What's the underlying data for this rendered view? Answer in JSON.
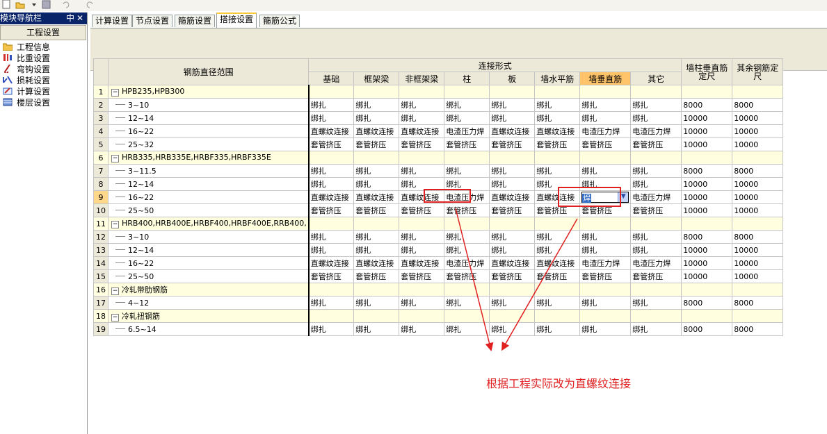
{
  "nav_panel": {
    "title": "模块导航栏",
    "pin": "中",
    "close": "✕",
    "section": "工程设置",
    "items": [
      {
        "label": "工程信息",
        "icon": "folder-info-icon"
      },
      {
        "label": "比重设置",
        "icon": "weight-icon"
      },
      {
        "label": "弯钩设置",
        "icon": "hook-icon"
      },
      {
        "label": "损耗设置",
        "icon": "loss-icon"
      },
      {
        "label": "计算设置",
        "icon": "calc-icon"
      },
      {
        "label": "楼层设置",
        "icon": "floor-icon"
      }
    ]
  },
  "tabs": [
    "计算设置",
    "节点设置",
    "箍筋设置",
    "搭接设置",
    "箍筋公式"
  ],
  "active_tab": "搭接设置",
  "table": {
    "header_range": "钢筋直径范围",
    "header_group": "连接形式",
    "columns": [
      "基础",
      "框架梁",
      "非框架梁",
      "柱",
      "板",
      "墙水平筋",
      "墙垂直筋",
      "其它"
    ],
    "col_extra1": "墙柱垂直筋定尺",
    "col_extra2": "其余钢筋定尺",
    "rows": [
      {
        "n": "1",
        "group": true,
        "label": "HPB235,HPB300",
        "cells": []
      },
      {
        "n": "2",
        "label": "3~10",
        "cells": [
          "绑扎",
          "绑扎",
          "绑扎",
          "绑扎",
          "绑扎",
          "绑扎",
          "绑扎",
          "绑扎",
          "8000",
          "8000"
        ]
      },
      {
        "n": "3",
        "label": "12~14",
        "cells": [
          "绑扎",
          "绑扎",
          "绑扎",
          "绑扎",
          "绑扎",
          "绑扎",
          "绑扎",
          "绑扎",
          "10000",
          "10000"
        ]
      },
      {
        "n": "4",
        "label": "16~22",
        "cells": [
          "直螺纹连接",
          "直螺纹连接",
          "直螺纹连接",
          "电渣压力焊",
          "直螺纹连接",
          "直螺纹连接",
          "电渣压力焊",
          "电渣压力焊",
          "10000",
          "10000"
        ]
      },
      {
        "n": "5",
        "label": "25~32",
        "cells": [
          "套管挤压",
          "套管挤压",
          "套管挤压",
          "套管挤压",
          "套管挤压",
          "套管挤压",
          "套管挤压",
          "套管挤压",
          "10000",
          "10000"
        ]
      },
      {
        "n": "6",
        "group": true,
        "label": "HRB335,HRB335E,HRBF335,HRBF335E",
        "cells": []
      },
      {
        "n": "7",
        "label": "3~11.5",
        "cells": [
          "绑扎",
          "绑扎",
          "绑扎",
          "绑扎",
          "绑扎",
          "绑扎",
          "绑扎",
          "绑扎",
          "8000",
          "8000"
        ]
      },
      {
        "n": "8",
        "label": "12~14",
        "cells": [
          "绑扎",
          "绑扎",
          "绑扎",
          "绑扎",
          "绑扎",
          "绑扎",
          "绑扎",
          "绑扎",
          "10000",
          "10000"
        ]
      },
      {
        "n": "9",
        "label": "16~22",
        "cells": [
          "直螺纹连接",
          "直螺纹连接",
          "直螺纹连接",
          "电渣压力焊",
          "直螺纹连接",
          "直螺纹连接",
          "焊",
          "电渣压力焊",
          "10000",
          "10000"
        ]
      },
      {
        "n": "10",
        "label": "25~50",
        "cells": [
          "套管挤压",
          "套管挤压",
          "套管挤压",
          "套管挤压",
          "套管挤压",
          "套管挤压",
          "套管挤压",
          "套管挤压",
          "10000",
          "10000"
        ]
      },
      {
        "n": "11",
        "group": true,
        "label": "HRB400,HRB400E,HRBF400,HRBF400E,RRB400,",
        "cells": []
      },
      {
        "n": "12",
        "label": "3~10",
        "cells": [
          "绑扎",
          "绑扎",
          "绑扎",
          "绑扎",
          "绑扎",
          "绑扎",
          "绑扎",
          "绑扎",
          "8000",
          "8000"
        ]
      },
      {
        "n": "13",
        "label": "12~14",
        "cells": [
          "绑扎",
          "绑扎",
          "绑扎",
          "绑扎",
          "绑扎",
          "绑扎",
          "绑扎",
          "绑扎",
          "10000",
          "10000"
        ]
      },
      {
        "n": "14",
        "label": "16~22",
        "cells": [
          "直螺纹连接",
          "直螺纹连接",
          "直螺纹连接",
          "电渣压力焊",
          "直螺纹连接",
          "直螺纹连接",
          "电渣压力焊",
          "电渣压力焊",
          "10000",
          "10000"
        ]
      },
      {
        "n": "15",
        "label": "25~50",
        "cells": [
          "套管挤压",
          "套管挤压",
          "套管挤压",
          "套管挤压",
          "套管挤压",
          "套管挤压",
          "套管挤压",
          "套管挤压",
          "10000",
          "10000"
        ]
      },
      {
        "n": "16",
        "group": true,
        "label": "冷轧带肋钢筋",
        "cells": []
      },
      {
        "n": "17",
        "label": "4~12",
        "cells": [
          "绑扎",
          "绑扎",
          "绑扎",
          "绑扎",
          "绑扎",
          "绑扎",
          "绑扎",
          "绑扎",
          "8000",
          "8000"
        ]
      },
      {
        "n": "18",
        "group": true,
        "label": "冷轧扭钢筋",
        "cells": []
      },
      {
        "n": "19",
        "label": "6.5~14",
        "cells": [
          "绑扎",
          "绑扎",
          "绑扎",
          "绑扎",
          "绑扎",
          "绑扎",
          "绑扎",
          "绑扎",
          "8000",
          "8000"
        ]
      }
    ],
    "selected_row": "9",
    "editing_value": "焊",
    "highlight_column": "墙垂直筋"
  },
  "annotation": "根据工程实际改为直螺纹连接",
  "colors": {
    "accent_red": "#e02020",
    "selected_header": "#ffc46a",
    "nav_header": "#0a246a"
  }
}
